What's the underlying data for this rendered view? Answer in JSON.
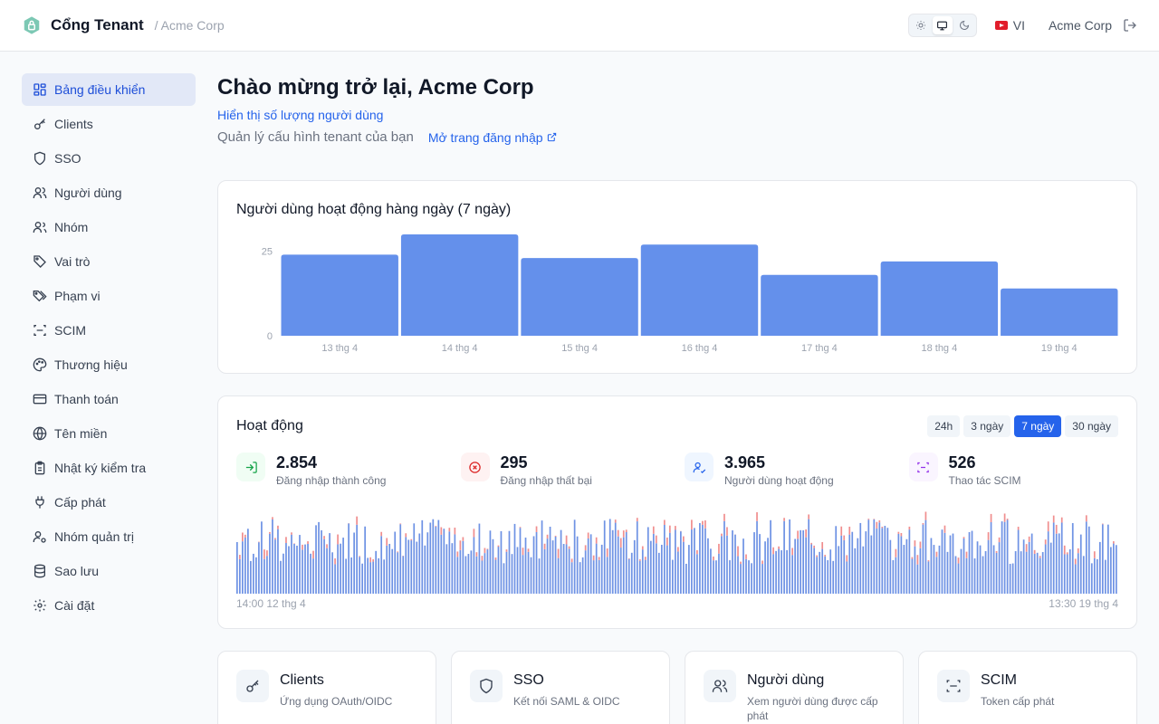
{
  "header": {
    "brand": "Cổng Tenant",
    "breadcrumb": "/ Acme Corp",
    "theme_options": [
      "light",
      "system",
      "dark"
    ],
    "theme_active": "system",
    "language": "VI",
    "user": "Acme Corp"
  },
  "sidebar": {
    "items": [
      {
        "label": "Bảng điều khiển",
        "icon": "dashboard-icon",
        "active": true
      },
      {
        "label": "Clients",
        "icon": "key-icon"
      },
      {
        "label": "SSO",
        "icon": "shield-icon"
      },
      {
        "label": "Người dùng",
        "icon": "users-icon"
      },
      {
        "label": "Nhóm",
        "icon": "group-icon"
      },
      {
        "label": "Vai trò",
        "icon": "tag-icon"
      },
      {
        "label": "Phạm vi",
        "icon": "tags-icon"
      },
      {
        "label": "SCIM",
        "icon": "scan-icon"
      },
      {
        "label": "Thương hiệu",
        "icon": "palette-icon"
      },
      {
        "label": "Thanh toán",
        "icon": "credit-card-icon"
      },
      {
        "label": "Tên miền",
        "icon": "globe-icon"
      },
      {
        "label": "Nhật ký kiểm tra",
        "icon": "clipboard-icon"
      },
      {
        "label": "Cấp phát",
        "icon": "plug-icon"
      },
      {
        "label": "Nhóm quản trị",
        "icon": "user-cog-icon"
      },
      {
        "label": "Sao lưu",
        "icon": "database-icon"
      },
      {
        "label": "Cài đặt",
        "icon": "gear-icon"
      }
    ]
  },
  "main": {
    "title": "Chào mừng trở lại, Acme Corp",
    "show_users_link": "Hiển thị số lượng người dùng",
    "subtitle": "Quản lý cấu hình tenant của bạn",
    "login_link": "Mở trang đăng nhập"
  },
  "daily_chart": {
    "title": "Người dùng hoạt động hàng ngày (7 ngày)"
  },
  "activity": {
    "title": "Hoạt động",
    "ranges": [
      "24h",
      "3 ngày",
      "7 ngày",
      "30 ngày"
    ],
    "active_range": "7 ngày",
    "stats": [
      {
        "value": "2.854",
        "label": "Đăng nhập thành công",
        "icon": "login-icon",
        "color": "#16a34a",
        "bg": "#f0fdf4"
      },
      {
        "value": "295",
        "label": "Đăng nhập thất bại",
        "icon": "x-circle-icon",
        "color": "#dc2626",
        "bg": "#fef2f2"
      },
      {
        "value": "3.965",
        "label": "Người dùng hoạt động",
        "icon": "user-check-icon",
        "color": "#2563eb",
        "bg": "#eff6ff"
      },
      {
        "value": "526",
        "label": "Thao tác SCIM",
        "icon": "scan-icon",
        "color": "#9333ea",
        "bg": "#faf5ff"
      }
    ],
    "start_label": "14:00 12 thg 4",
    "end_label": "13:30 19 thg 4",
    "colors": {
      "success": "#6e92e4",
      "failure": "#f08e8e"
    }
  },
  "quick_cards": [
    {
      "title": "Clients",
      "desc": "Ứng dụng OAuth/OIDC",
      "icon": "key-icon"
    },
    {
      "title": "SSO",
      "desc": "Kết nối SAML & OIDC",
      "icon": "shield-icon"
    },
    {
      "title": "Người dùng",
      "desc": "Xem người dùng được cấp phát",
      "icon": "users-icon"
    },
    {
      "title": "SCIM",
      "desc": "Token cấp phát",
      "icon": "scan-icon"
    }
  ],
  "chart_data": {
    "type": "bar",
    "title": "Người dùng hoạt động hàng ngày (7 ngày)",
    "categories": [
      "13 thg 4",
      "14 thg 4",
      "15 thg 4",
      "16 thg 4",
      "17 thg 4",
      "18 thg 4",
      "19 thg 4"
    ],
    "values": [
      24,
      30,
      23,
      27,
      18,
      22,
      14
    ],
    "yticks": [
      0,
      25
    ],
    "ylim": [
      0,
      30
    ],
    "color": "#6490eb"
  }
}
